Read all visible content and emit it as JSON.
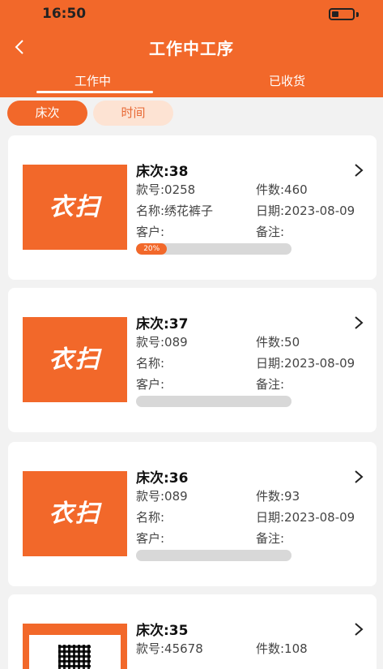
{
  "status_bar": {
    "time": "16:50"
  },
  "header": {
    "title": "工作中工序",
    "tabs": [
      {
        "label": "工作中",
        "active": true
      },
      {
        "label": "已收货",
        "active": false
      }
    ]
  },
  "filters": [
    {
      "label": "床次",
      "active": true
    },
    {
      "label": "时间",
      "active": false
    }
  ],
  "cards": [
    {
      "thumbnail": "logo",
      "logo_text": "衣扫",
      "bed": "床次:38",
      "style_no": "款号:0258",
      "pieces": "件数:460",
      "name": "名称:绣花裤子",
      "date": "日期:2023-08-09",
      "customer": "客户:",
      "remark": "备注:",
      "progress": 0.2,
      "progress_label": "20%"
    },
    {
      "thumbnail": "logo",
      "logo_text": "衣扫",
      "bed": "床次:37",
      "style_no": "款号:089",
      "pieces": "件数:50",
      "name": "名称:",
      "date": "日期:2023-08-09",
      "customer": "客户:",
      "remark": "备注:",
      "progress": 0,
      "progress_label": ""
    },
    {
      "thumbnail": "logo",
      "logo_text": "衣扫",
      "bed": "床次:36",
      "style_no": "款号:089",
      "pieces": "件数:93",
      "name": "名称:",
      "date": "日期:2023-08-09",
      "customer": "客户:",
      "remark": "备注:",
      "progress": 0,
      "progress_label": ""
    },
    {
      "thumbnail": "qr-photo",
      "bed": "床次:35",
      "style_no": "款号:45678",
      "pieces": "件数:108"
    }
  ],
  "colors": {
    "brand": "#f2682a",
    "chip_inactive_bg": "#fde3d3",
    "track": "#d8d8d8"
  },
  "icons": {
    "back": "chevron-left-icon",
    "card_arrow": "chevron-right-icon",
    "battery": "battery-icon"
  }
}
